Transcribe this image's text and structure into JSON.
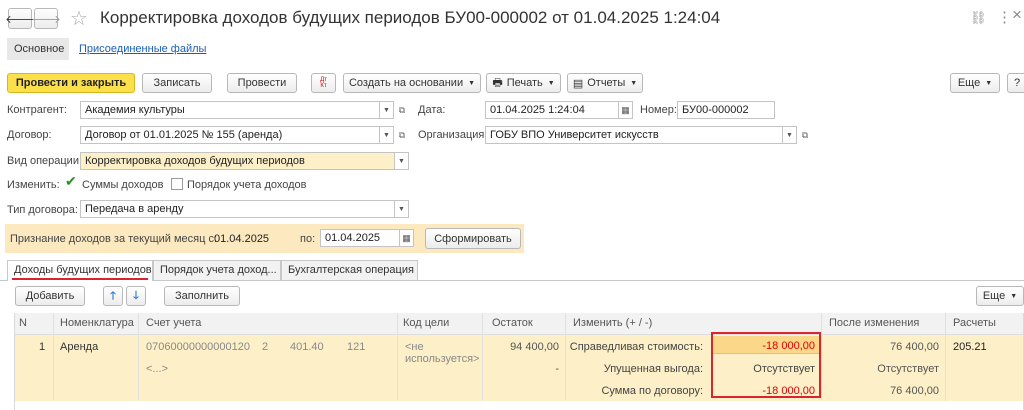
{
  "window": {
    "title": "Корректировка доходов будущих периодов БУ00-000002 от 01.04.2025 1:24:04",
    "nav_back": "🡐",
    "nav_forward": "🡒",
    "star": "☆",
    "link_icon": "🔗",
    "menu_icon": "⋮",
    "maximize_icon": "□",
    "close_icon": "×"
  },
  "sections": {
    "main": "Основное",
    "files": "Присоединенные файлы"
  },
  "toolbar": {
    "post_close": "Провести и закрыть",
    "save": "Записать",
    "post": "Провести",
    "dtkt_icon": "Дт Кт",
    "create_based": "Создать на основании",
    "print": "Печать",
    "reports": "Отчеты",
    "more": "Еще",
    "help": "?"
  },
  "form": {
    "counterparty_label": "Контрагент:",
    "counterparty_value": "Академия культуры",
    "date_label": "Дата:",
    "date_value": "01.04.2025  1:24:04",
    "number_label": "Номер:",
    "number_value": "БУ00-000002",
    "contract_label": "Договор:",
    "contract_value": "Договор от 01.01.2025 № 155 (аренда)",
    "org_label": "Организация:",
    "org_value": "ГОБУ ВПО Университет искусств",
    "op_label": "Вид операции:",
    "op_value": "Корректировка доходов будущих периодов",
    "change_label": "Изменить:",
    "cb_sums": "Суммы доходов",
    "cb_sums_checked": true,
    "cb_order": "Порядок учета доходов",
    "cb_order_checked": false,
    "contract_type_label": "Тип договора:",
    "contract_type_value": "Передача в аренду",
    "recog_label": "Признание доходов за текущий месяц с:",
    "recog_from": "01.04.2025",
    "recog_to_label": "по:",
    "recog_to": "01.04.2025",
    "generate": "Сформировать"
  },
  "tabs": [
    "Доходы будущих периодов",
    "Порядок учета доход...",
    "Бухгалтерская операция"
  ],
  "table_toolbar": {
    "add": "Добавить",
    "up": "🡑",
    "down": "🡓",
    "fill": "Заполнить",
    "more": "Еще"
  },
  "table": {
    "headers": [
      "N",
      "Номенклатура",
      "Счет учета",
      "Код цели",
      "Остаток",
      "Изменить (+ / -)",
      "После изменения",
      "Расчеты"
    ],
    "row": {
      "n": "1",
      "nomenclature": "Аренда",
      "account": "07060000000000120",
      "acc_part2": "2",
      "acc_part3": "401.40",
      "acc_part4": "121",
      "acc_sub": "<...>",
      "goal_code": "<не используется>",
      "balance": "94 400,00",
      "balance_dash": "-",
      "change_labels": [
        "Справедливая стоимость:",
        "Упущенная выгода:",
        "Сумма по договору:"
      ],
      "change_values": [
        "-18 000,00",
        "Отсутствует",
        "-18 000,00"
      ],
      "after_values": [
        "76 400,00",
        "Отсутствует",
        "76 400,00"
      ],
      "calc": "205.21"
    }
  },
  "colors": {
    "accent_yellow": "#fbe04c",
    "highlight_row": "#fdf0c8",
    "negative": "#e00000",
    "link": "#1a5fb4",
    "red_box": "#d9262c"
  }
}
